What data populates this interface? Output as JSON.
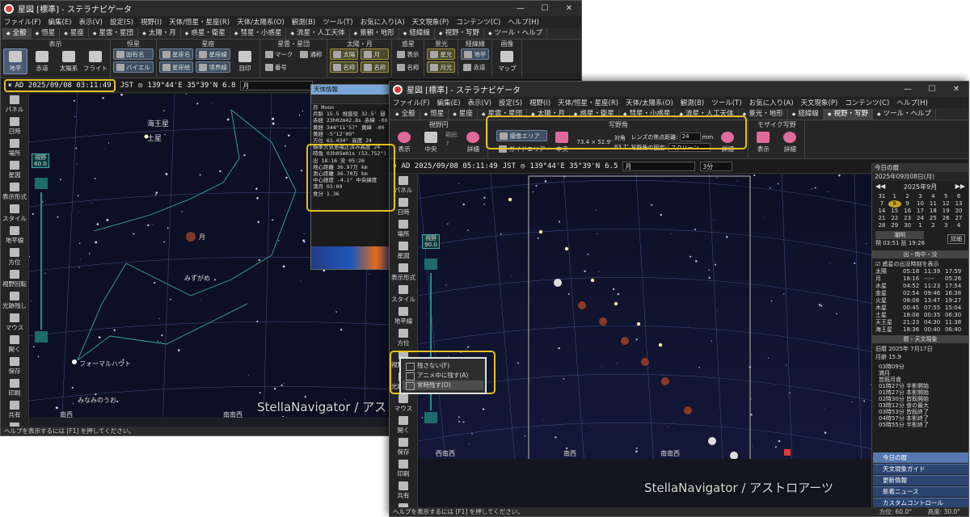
{
  "window1": {
    "title": "星図 [標準] - ステラナビゲータ",
    "menu": [
      "ファイル(F)",
      "編集(E)",
      "表示(V)",
      "設定(S)",
      "視野(I)",
      "天体/恒星・星座(R)",
      "天体/太陽系(O)",
      "観測(B)",
      "ツール(T)",
      "お気に入り(A)",
      "天文現象(P)",
      "コンテンツ(C)",
      "ヘルプ(H)"
    ],
    "tabs": [
      "全般",
      "恒星",
      "星座",
      "星雲・星団",
      "太陽・月",
      "惑星・衛星",
      "彗星・小惑星",
      "流星・人工天体",
      "景観・地形",
      "経緯線",
      "視野・写野",
      "ツール・ヘルプ"
    ],
    "ribbon": {
      "groups": [
        "表示",
        "恒星",
        "星座",
        "星雲・星団",
        "太陽・月",
        "惑星",
        "景光",
        "経緯線",
        "画像"
      ],
      "buttons": [
        "地平",
        "赤道",
        "太陽系",
        "フライト",
        "固有名",
        "バイエル",
        "星座名",
        "星座線",
        "星座絵",
        "境界線",
        "目印",
        "マーク",
        "番号",
        "通称",
        "太陽",
        "月",
        "名称",
        "名称",
        "表示",
        "名称",
        "星光",
        "月光",
        "地平",
        "赤道",
        "マップ"
      ]
    },
    "status": {
      "datetime": "AD 2025/09/08 03:11:49",
      "tz": "JST",
      "coords": "139°44'E 35°39'N",
      "mag": "6.8",
      "object": "月",
      "step": "3分"
    },
    "left_panel": [
      "パネル",
      "日時",
      "場所",
      "星図",
      "表示形式",
      "スタイル",
      "地平線",
      "方位",
      "視野回転",
      "光跡残し",
      "マウス",
      "開く",
      "保存",
      "印刷",
      "共有",
      "元に戻す"
    ],
    "fov": {
      "label": "視野",
      "value": "60.0"
    },
    "sky_labels": {
      "neptune": "海王星",
      "saturn": "土星",
      "moon": "月",
      "aquarius": "みずがめ",
      "fomalhaut": "フォーマルハウト",
      "piscis": "みなみのうお",
      "sw": "南西",
      "ssw": "南南西"
    },
    "info_panel": {
      "title": "天体情報",
      "lines": [
        "月 Moon",
        "月齢 15.5  視直径 32.5'  昼",
        "赤経 23h02m42.8s  赤緯 -08",
        "黄経 344°11'57\"  黄緯 -00",
        "黄経 -5°12'09\"",
        "方位 61.434°  高度 24",
        "標準大気差補正済み高度 24",
        "時角 03h05m01s (53.752°)",
        "出 18:16  没 05:26",
        "地心距離 36.97万 km",
        "測心距離 36.70万 km",
        "中心経度 -4.1° 中央緯度",
        "満月 03:09",
        "食分 1.36"
      ]
    },
    "footer": "ヘルプを表示するには [F1] を押してください。",
    "watermark": "StellaNavigator / アストロアーツ"
  },
  "window2": {
    "title": "星図 [標準] - ステラナビゲータ",
    "menu": [
      "ファイル(F)",
      "編集(E)",
      "表示(V)",
      "設定(S)",
      "視野(I)",
      "天体/恒星・星座(R)",
      "天体/太陽系(O)",
      "観測(B)",
      "ツール(T)",
      "お気に入り(A)",
      "天文現象(P)",
      "コンテンツ(C)",
      "ヘルプ(H)"
    ],
    "tabs": [
      "全般",
      "恒星",
      "星座",
      "星雲・星団",
      "太陽・月",
      "惑星・衛星",
      "彗星・小惑星",
      "流星・人工天体",
      "景光・地形",
      "経緯線",
      "視野・写野",
      "ツール・ヘルプ"
    ],
    "ribbon": {
      "fov_group": "視野円",
      "photo_group": "写野角",
      "mosaic_group": "モザイク写野",
      "buttons": {
        "show": "表示",
        "center": "中央",
        "detail": "詳細",
        "range": "範囲:",
        "photo_area": "撮像エリア",
        "guide_area": "ガイドエリア",
        "size": "73.4 × 52.9'",
        "diag_label": "対角",
        "diag": "83.7'",
        "focal_label": "レンズの焦点距離:",
        "focal": "24",
        "mm": "mm",
        "fix_label": "写野角の固定:",
        "fix": "スクリーン",
        "range_value": "7"
      }
    },
    "status": {
      "datetime": "AD 2025/09/08 05:11:49",
      "tz": "JST",
      "coords": "139°44'E 35°39'N",
      "mag": "6.5",
      "object": "月",
      "step": "3分"
    },
    "left_panel": [
      "パネル",
      "日時",
      "場所",
      "星図",
      "表示形式",
      "スタイル",
      "地平線",
      "方位",
      "視野回転",
      "光跡残し",
      "マウス",
      "開く",
      "保存",
      "印刷",
      "共有",
      "元に戻す"
    ],
    "fov": {
      "label": "視野",
      "value": "90.0"
    },
    "popup": [
      "残さない(F)",
      "アニメ中に残す(A)",
      "常時残す(O)"
    ],
    "sky_labels": {
      "wsw": "西南西",
      "sw": "南西",
      "ssw": "南南西"
    },
    "right_panel": {
      "title": "今日の暦",
      "date": "2025年09月08日(月)",
      "month": "2025年9月",
      "cal_rows": [
        [
          "31",
          "1",
          "2",
          "3",
          "4",
          "5",
          "6"
        ],
        [
          "7",
          "8",
          "9",
          "10",
          "11",
          "12",
          "13"
        ],
        [
          "14",
          "15",
          "16",
          "17",
          "18",
          "19",
          "20"
        ],
        [
          "21",
          "22",
          "23",
          "24",
          "25",
          "26",
          "27"
        ],
        [
          "28",
          "29",
          "30",
          "1",
          "2",
          "3",
          "4"
        ]
      ],
      "tide": "潮明",
      "tide_vals": "朔 03:51  瓩 19:26",
      "detail": "詳細",
      "rise_set_title": "出・南中・没",
      "check_label": "惑星の出没時刻を表示",
      "rise_set": [
        [
          "太陽",
          "05:18",
          "11:39",
          "17:59"
        ],
        [
          "月",
          "18:16",
          "--:--",
          "05:26"
        ],
        [
          "水星",
          "04:52",
          "11:23",
          "17:54"
        ],
        [
          "金星",
          "02:54",
          "09:46",
          "16:38"
        ],
        [
          "火星",
          "08:08",
          "13:47",
          "19:27"
        ],
        [
          "木星",
          "00:45",
          "07:55",
          "15:04"
        ],
        [
          "土星",
          "18:08",
          "00:35",
          "06:30"
        ],
        [
          "天王星",
          "21:23",
          "04:30",
          "11:38"
        ],
        [
          "海王星",
          "18:36",
          "00:40",
          "06:40"
        ]
      ],
      "calendar_title": "暦・天文現象",
      "lunar": "旧暦 2025年 7月17日",
      "age": "月齢 15.9",
      "events": [
        "03時09分",
        "満月",
        "皆既月食",
        "01時27分 半影開始",
        "01時27分 本影開始",
        "02時30分 皆既開始",
        "03時12分 食の最大",
        "03時53分 皆既終了",
        "04時57分 本影終了",
        "05時55分 半影終了"
      ],
      "bottom_tabs": [
        "今日の暦",
        "天文現象ガイド",
        "更新情報",
        "新着ニュース",
        "カスタムコントロール"
      ]
    },
    "footer": "ヘルプを表示するには [F1] を押してください。",
    "footer_right": [
      "方位: 60.0°",
      "高度: 30.0°"
    ],
    "watermark": "StellaNavigator / アストロアーツ"
  }
}
